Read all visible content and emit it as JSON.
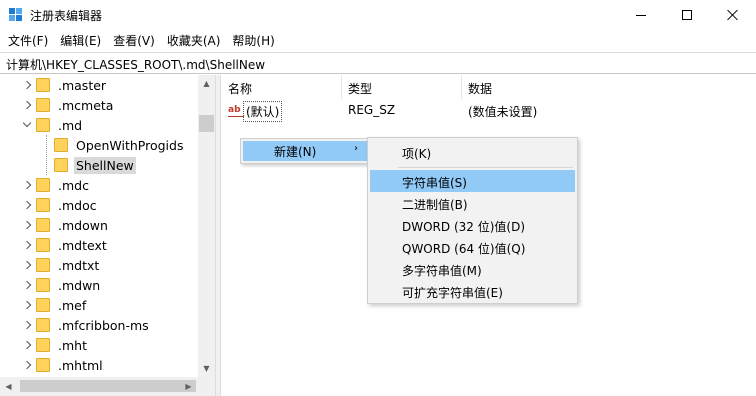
{
  "window": {
    "title": "注册表编辑器",
    "icon": "registry-editor-icon"
  },
  "menubar": [
    "文件(F)",
    "编辑(E)",
    "查看(V)",
    "收藏夹(A)",
    "帮助(H)"
  ],
  "address": "计算机\\HKEY_CLASSES_ROOT\\.md\\ShellNew",
  "tree": {
    "items": [
      {
        "label": ".master",
        "state": "collapsed"
      },
      {
        "label": ".mcmeta",
        "state": "collapsed"
      },
      {
        "label": ".md",
        "state": "expanded"
      },
      {
        "label": "OpenWithProgids",
        "state": "child"
      },
      {
        "label": "ShellNew",
        "state": "child-selected"
      },
      {
        "label": ".mdc",
        "state": "collapsed"
      },
      {
        "label": ".mdoc",
        "state": "collapsed"
      },
      {
        "label": ".mdown",
        "state": "collapsed"
      },
      {
        "label": ".mdtext",
        "state": "collapsed"
      },
      {
        "label": ".mdtxt",
        "state": "collapsed"
      },
      {
        "label": ".mdwn",
        "state": "collapsed"
      },
      {
        "label": ".mef",
        "state": "collapsed"
      },
      {
        "label": ".mfcribbon-ms",
        "state": "collapsed"
      },
      {
        "label": ".mht",
        "state": "collapsed"
      },
      {
        "label": ".mhtml",
        "state": "collapsed"
      }
    ]
  },
  "list": {
    "columns": [
      "名称",
      "类型",
      "数据"
    ],
    "rows": [
      {
        "name": "(默认)",
        "type": "REG_SZ",
        "data": "(数值未设置)",
        "icon": "string-value-icon"
      }
    ]
  },
  "context_menu": {
    "new_label": "新建(N)",
    "arrow": "›"
  },
  "new_submenu": {
    "items": [
      "项(K)",
      "字符串值(S)",
      "二进制值(B)",
      "DWORD (32 位)值(D)",
      "QWORD (64 位)值(Q)",
      "多字符串值(M)",
      "可扩充字符串值(E)"
    ],
    "highlighted_index": 1
  },
  "colors": {
    "highlight": "#91c9f7",
    "folder": "#ffd35b",
    "selected_tree": "#d9d9d9"
  }
}
